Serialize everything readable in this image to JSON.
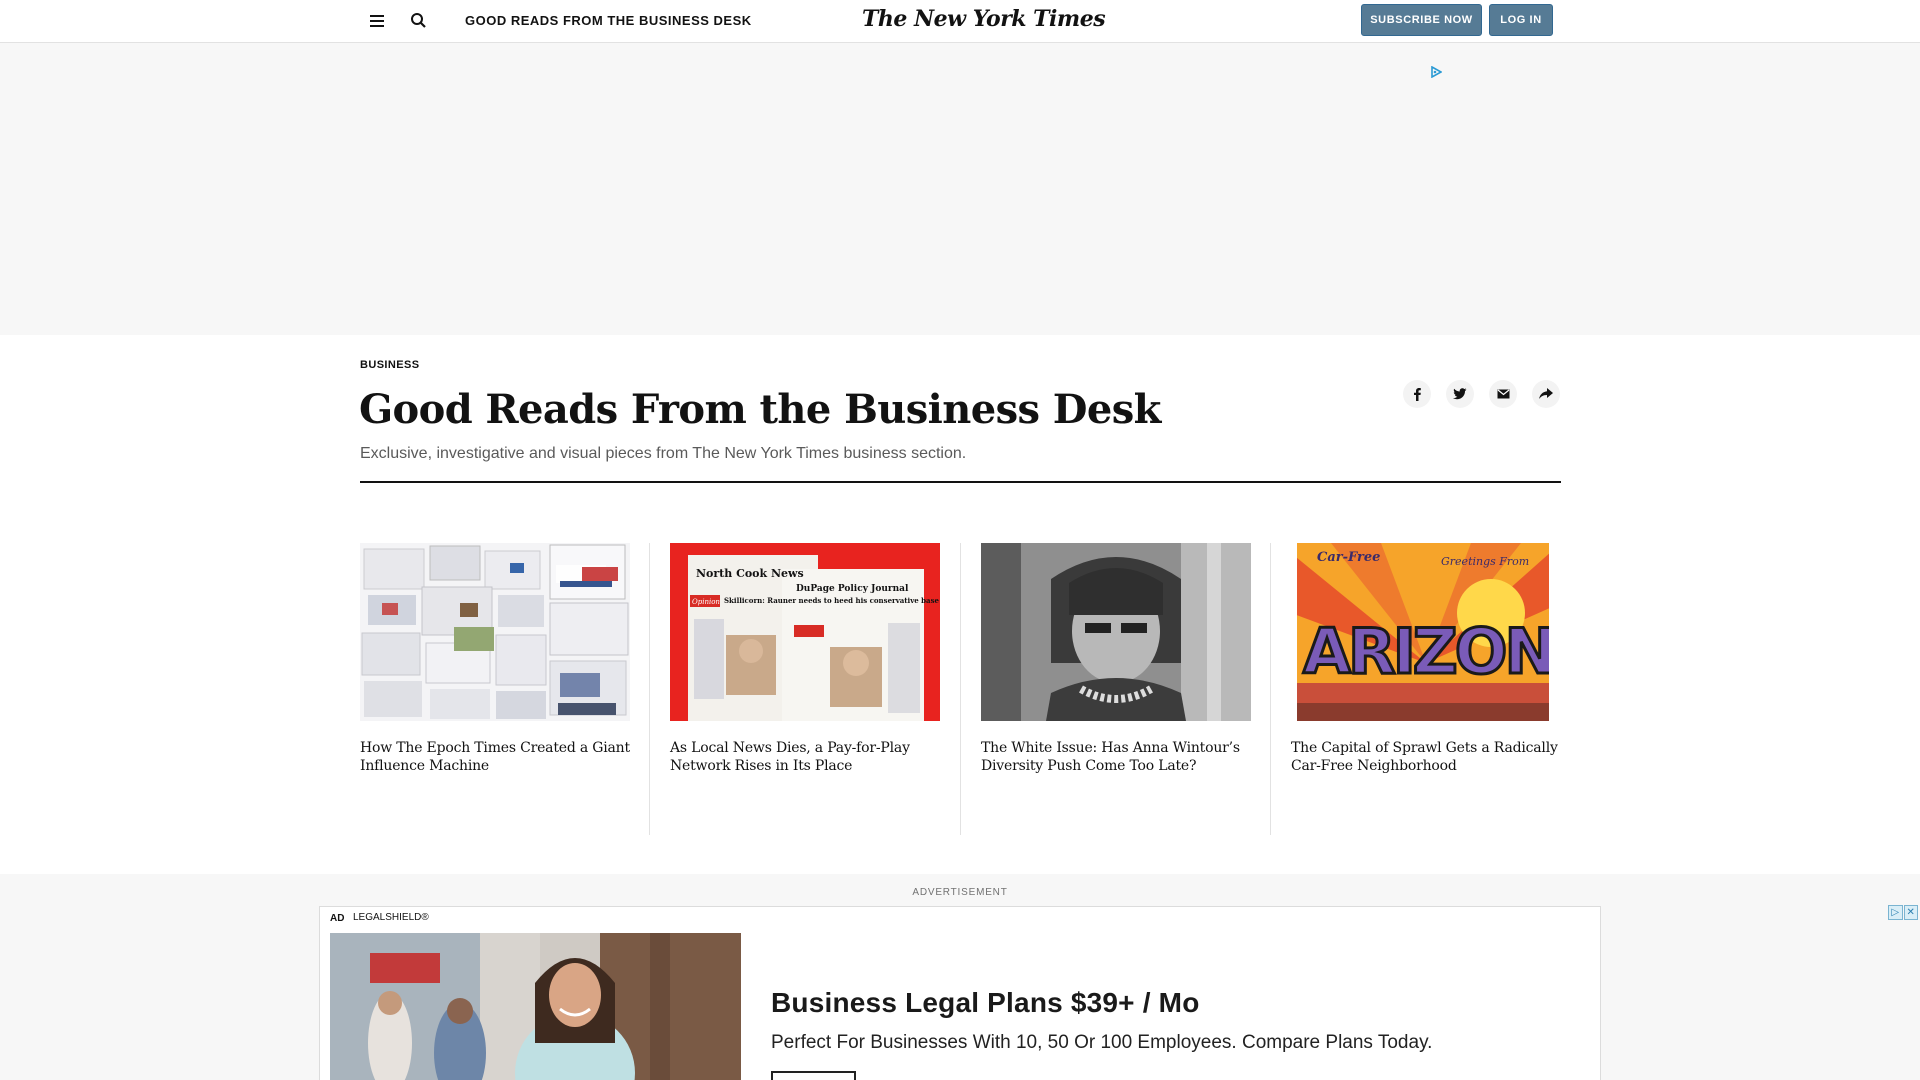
{
  "header": {
    "section_title": "GOOD READS FROM THE BUSINESS DESK",
    "logo": "The New York Times",
    "subscribe_label": "SUBSCRIBE NOW",
    "login_label": "LOG IN",
    "icons": [
      "hamburger-menu-icon",
      "search-icon"
    ]
  },
  "article": {
    "kicker": "BUSINESS",
    "headline": "Good Reads From the Business Desk",
    "dek": "Exclusive, investigative and visual pieces from The New York Times business section.",
    "share_icons": [
      "facebook-icon",
      "twitter-icon",
      "email-icon",
      "share-arrow-icon"
    ]
  },
  "stories": [
    {
      "title": "How The Epoch Times Created a Giant Influence Machine"
    },
    {
      "title": "As Local News Dies, a Pay-for-Play Network Rises in Its Place",
      "thumb_text": [
        "North Cook News",
        "DuPage Policy Journal",
        "Opinion",
        "Skillicorn: Rauner needs to heed his conservative base"
      ]
    },
    {
      "title": "The White Issue: Has Anna Wintour’s Diversity Push Come Too Late?"
    },
    {
      "title": "The Capital of Sprawl Gets a Radically Car-Free Neighborhood",
      "thumb_text": [
        "Car-Free",
        "Greetings From",
        "ARIZONA"
      ]
    }
  ],
  "bottom_ad": {
    "label": "ADVERTISEMENT",
    "ad_tag": "AD",
    "sponsor": "LEGALSHIELD®",
    "headline": "Business Legal Plans $39+ / Mo",
    "subtext": "Perfect For Businesses With 10, 50 Or 100 Employees. Compare Plans Today."
  },
  "colors": {
    "button_bg": "#567b95",
    "text": "#121212",
    "ad_bg": "#f7f7f7"
  }
}
